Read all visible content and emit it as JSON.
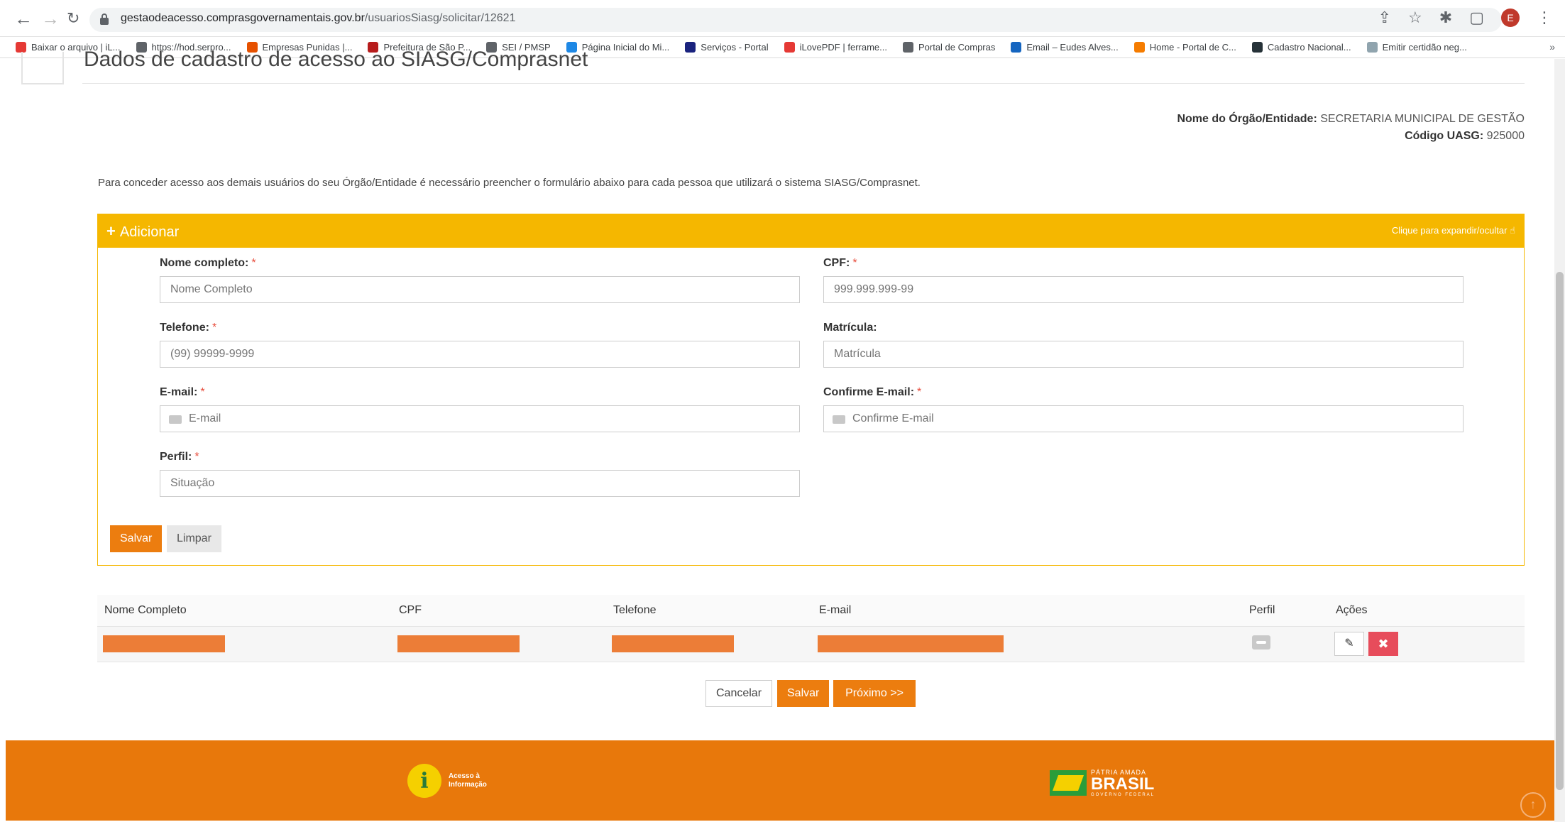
{
  "browser": {
    "url_domain": "gestaodeacesso.comprasgovernamentais.gov.br",
    "url_path": "/usuariosSiasg/solicitar/12621",
    "profile_initial": "E",
    "bookmarks": [
      {
        "label": "Baixar o arquivo | iL...",
        "color": "#e53935"
      },
      {
        "label": "https://hod.serpro...",
        "color": "#5f6368"
      },
      {
        "label": "Empresas Punidas |...",
        "color": "#e65100"
      },
      {
        "label": "Prefeitura de São P...",
        "color": "#b71c1c"
      },
      {
        "label": "SEI / PMSP",
        "color": "#5f6368"
      },
      {
        "label": "Página Inicial do Mi...",
        "color": "#1e88e5"
      },
      {
        "label": "Serviços - Portal",
        "color": "#1a237e"
      },
      {
        "label": "iLovePDF | ferrame...",
        "color": "#e53935"
      },
      {
        "label": "Portal de Compras",
        "color": "#5f6368"
      },
      {
        "label": "Email – Eudes Alves...",
        "color": "#1565c0"
      },
      {
        "label": "Home - Portal de C...",
        "color": "#f57c00"
      },
      {
        "label": "Cadastro Nacional...",
        "color": "#263238"
      },
      {
        "label": "Emitir certidão neg...",
        "color": "#90a4ae"
      }
    ],
    "more": "»"
  },
  "page": {
    "title": "Dados de cadastro de acesso ao SIASG/Comprasnet",
    "org_label": "Nome do Órgão/Entidade:",
    "org_value": "SECRETARIA MUNICIPAL DE GESTÃO",
    "uasg_label": "Código UASG:",
    "uasg_value": "925000",
    "intro": "Para conceder acesso aos demais usuários do seu Órgão/Entidade é necessário preencher o formulário abaixo para cada pessoa que utilizará o sistema SIASG/Comprasnet."
  },
  "panel": {
    "plus": "+",
    "title": "Adicionar",
    "toggle": "Clique para expandir/ocultar",
    "toggle_icon": "hand-pointer-icon"
  },
  "form": {
    "required_mark": "*",
    "nome_label": "Nome completo:",
    "nome_placeholder": "Nome Completo",
    "cpf_label": "CPF:",
    "cpf_placeholder": "999.999.999-99",
    "telefone_label": "Telefone:",
    "telefone_placeholder": "(99) 99999-9999",
    "matricula_label": "Matrícula:",
    "matricula_placeholder": "Matrícula",
    "email_label": "E-mail:",
    "email_placeholder": "E-mail",
    "confirm_label": "Confirme E-mail:",
    "confirm_placeholder": "Confirme E-mail",
    "perfil_label": "Perfil:",
    "perfil_placeholder": "Situação",
    "save": "Salvar",
    "clear": "Limpar"
  },
  "table": {
    "headers": [
      "Nome Completo",
      "CPF",
      "Telefone",
      "E-mail",
      "Perfil",
      "Ações"
    ],
    "edit_icon": "✎",
    "delete_icon": "✖"
  },
  "actions": {
    "cancel": "Cancelar",
    "save": "Salvar",
    "next": "Próximo >>"
  },
  "footer": {
    "info_letter": "i",
    "info_line1": "Acesso à",
    "info_line2": "Informação",
    "brasil_top": "PÁTRIA AMADA",
    "brasil_main": "BRASIL",
    "brasil_sub": "GOVERNO FEDERAL",
    "up_icon": "↑"
  },
  "colors": {
    "accent_orange": "#ec7d0f",
    "panel_yellow": "#f5b700",
    "delete_red": "#e74c5b"
  }
}
